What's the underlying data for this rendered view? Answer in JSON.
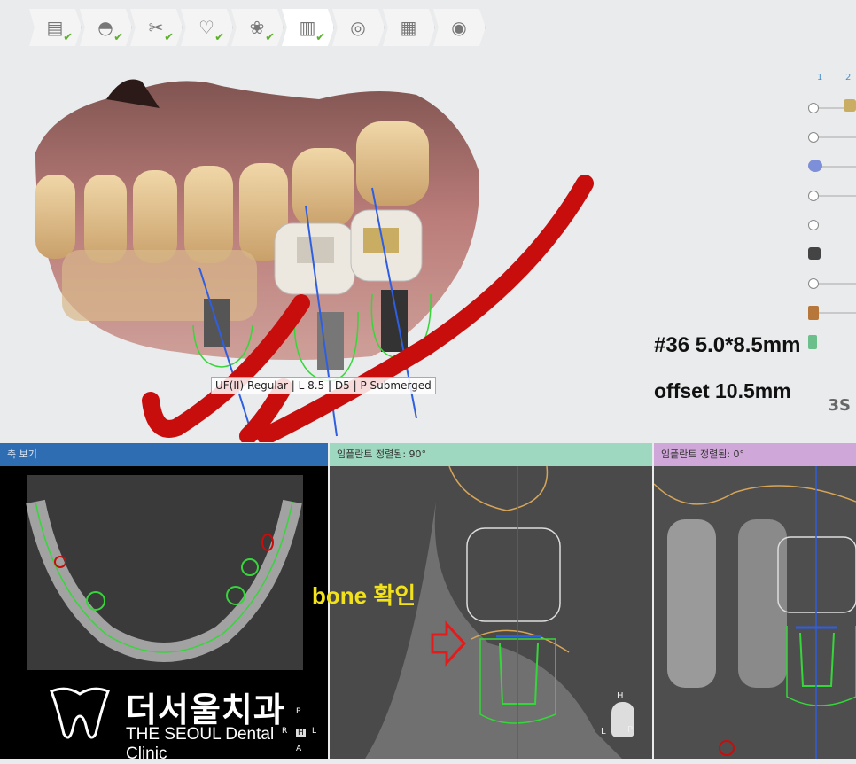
{
  "toolbar": {
    "steps": [
      {
        "icon": "document-icon",
        "glyph": "▤",
        "completed": true
      },
      {
        "icon": "scanner-icon",
        "glyph": "◓",
        "completed": true
      },
      {
        "icon": "tools-icon",
        "glyph": "✂",
        "completed": true
      },
      {
        "icon": "tooth-icon",
        "glyph": "♡",
        "completed": true
      },
      {
        "icon": "nerve-icon",
        "glyph": "❀",
        "completed": true
      },
      {
        "icon": "implant-icon",
        "glyph": "▥",
        "completed": true,
        "active": true
      },
      {
        "icon": "guide-icon",
        "glyph": "◎",
        "completed": false
      },
      {
        "icon": "report-icon",
        "glyph": "▦",
        "completed": false
      },
      {
        "icon": "disc-icon",
        "glyph": "◉",
        "completed": false
      }
    ]
  },
  "viewport": {
    "implant_tooltip": "UF(II) Regular | L 8.5 | D5 | P Submerged",
    "annotation_size": "#36 5.0*8.5mm",
    "annotation_offset": "offset 10.5mm",
    "side_numbers": [
      "1",
      "2"
    ],
    "corner_label": "3S"
  },
  "panels": {
    "axial": {
      "title": "축 보기"
    },
    "aligned90": {
      "title": "임플란트 정렬됨: 90°"
    },
    "aligned0": {
      "title": "임플란트 정렬됨: 0°"
    }
  },
  "note": "bone 확인",
  "logo": {
    "ko": "더서울치과",
    "en": "THE SEOUL Dental Clinic"
  },
  "orientation": {
    "top": "P",
    "left": "R",
    "center": "H",
    "right": "L",
    "bottom": "A"
  },
  "orientation2": {
    "top": "H",
    "left": "L",
    "right": "P"
  },
  "colors": {
    "nerve": "#c80d0d",
    "implant_outline": "#36d63a",
    "axis": "#2f5fe0",
    "arrow": "#e41b1b",
    "note": "#f2e21c"
  }
}
